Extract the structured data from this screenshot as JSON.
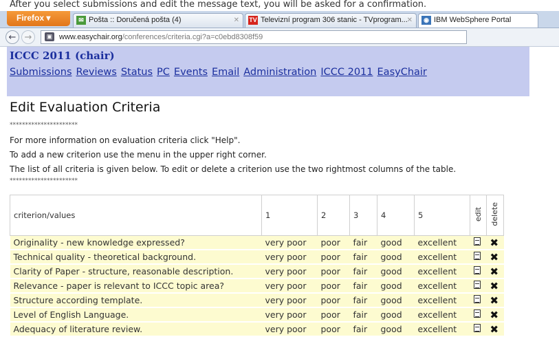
{
  "top_note": "After you select submissions and edit the message text, you will be asked for a confirmation.",
  "browser": {
    "firefox_label": "Firefox",
    "tabs": [
      {
        "title": "Pošta :: Doručená pošta (4)",
        "icon": "mail-icon"
      },
      {
        "title": "Televizní program 306 stanic - TVprogram...",
        "icon": "tv-icon"
      },
      {
        "title": "IBM WebSphere Portal",
        "icon": "portal-icon"
      }
    ],
    "url_domain": "www.easychair.org",
    "url_path": "/conferences/criteria.cgi?a=c0ebd8308f59"
  },
  "header": {
    "conference": "ICCC 2011 (chair)",
    "menu": [
      "Submissions",
      "Reviews",
      "Status",
      "PC",
      "Events",
      "Email",
      "Administration",
      "ICCC 2011",
      "EasyChair"
    ]
  },
  "page": {
    "title": "Edit Evaluation Criteria",
    "stars": "**********************",
    "info1": "For more information on evaluation criteria click \"Help\".",
    "info2": "To add a new criterion use the menu in the upper right corner.",
    "info3": "The list of all criteria is given below. To edit or delete a criterion use the two rightmost columns of the table."
  },
  "table": {
    "headers": [
      "criterion/values",
      "1",
      "2",
      "3",
      "4",
      "5",
      "edit",
      "delete"
    ],
    "rows": [
      {
        "criterion": "Originality - new knowledge expressed?",
        "values": [
          "very poor",
          "poor",
          "fair",
          "good",
          "excellent"
        ]
      },
      {
        "criterion": "Technical quality - theoretical background.",
        "values": [
          "very poor",
          "poor",
          "fair",
          "good",
          "excellent"
        ]
      },
      {
        "criterion": "Clarity of Paper - structure, reasonable description.",
        "values": [
          "very poor",
          "poor",
          "fair",
          "good",
          "excellent"
        ]
      },
      {
        "criterion": "Relevance - paper is relevant to ICCC topic area?",
        "values": [
          "very poor",
          "poor",
          "fair",
          "good",
          "excellent"
        ]
      },
      {
        "criterion": "Structure according template.",
        "values": [
          "very poor",
          "poor",
          "fair",
          "good",
          "excellent"
        ]
      },
      {
        "criterion": "Level of English Language.",
        "values": [
          "very poor",
          "poor",
          "fair",
          "good",
          "excellent"
        ]
      },
      {
        "criterion": "Adequacy of literature review.",
        "values": [
          "very poor",
          "poor",
          "fair",
          "good",
          "excellent"
        ]
      }
    ]
  },
  "colors": {
    "header_bg": "#c5cbef",
    "link": "#1b2f9e",
    "row_bg": "#fdfbd0"
  }
}
